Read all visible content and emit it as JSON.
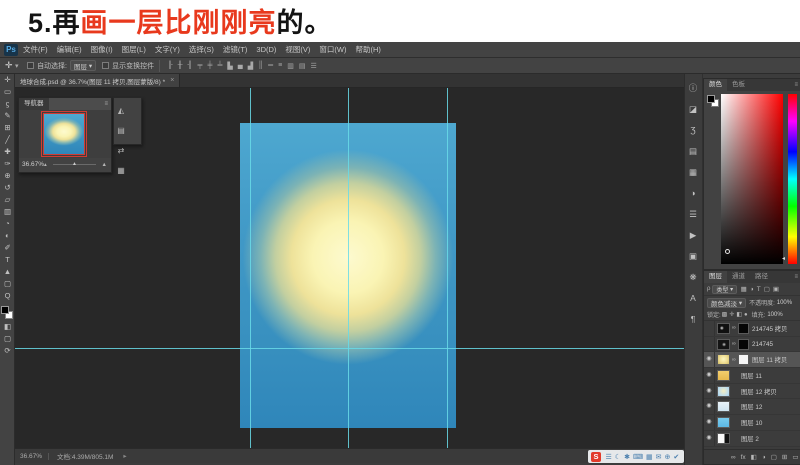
{
  "title": {
    "prefix": "5.再",
    "highlight": "画一层比刚刚亮",
    "suffix": "的。"
  },
  "menu_bar": {
    "logo": "Ps",
    "items": [
      "文件(F)",
      "编辑(E)",
      "图像(I)",
      "图层(L)",
      "文字(Y)",
      "选择(S)",
      "滤镜(T)",
      "3D(D)",
      "视图(V)",
      "窗口(W)",
      "帮助(H)"
    ]
  },
  "options_bar": {
    "tool_glyph": "✛",
    "tool_arrow": "▾",
    "auto_select_label": "自动选择:",
    "auto_select_value": "图层",
    "select_arrow": "▾",
    "transform_label": "显示变换控件",
    "align_icons": [
      "╟",
      "╫",
      "╢",
      "╤",
      "╪",
      "╧",
      "▙",
      "▄",
      "▟",
      "║",
      "═",
      "≡",
      "▥",
      "▤",
      "☰"
    ]
  },
  "toolbar": {
    "tools": [
      "✛",
      "▭",
      "ϛ",
      "✎",
      "⊞",
      "╱",
      "✚",
      "✑",
      "⊕",
      "↺",
      "▱",
      "▥",
      "◔",
      "◐",
      "✐",
      "T",
      "▲",
      "▢",
      "Q"
    ],
    "bottom_icons": [
      "◧",
      "▢",
      "⟳"
    ]
  },
  "document": {
    "tab_title": "地球合成.psd @ 36.7%(图层 11 拷贝,图层蒙版/8) *",
    "close_glyph": "×"
  },
  "navigator": {
    "tab": "导航器",
    "menu_icon": "≡",
    "zoom": "36.67%",
    "slider_thumb": "▲",
    "mount_small": "▴",
    "mount_large": "▲"
  },
  "collapsed_panel": {
    "icons": [
      "◭",
      "▤",
      "⇄",
      "▦"
    ]
  },
  "status_bar": {
    "zoom": "36.67%",
    "doc_info": "文档:4.39M/805.1M",
    "arrow": "▸"
  },
  "sogou": {
    "logo": "S",
    "icons": [
      "☰",
      "☾",
      "✱",
      "⌨",
      "▦",
      "✉",
      "⊕",
      "✔"
    ]
  },
  "right_strip": {
    "icons": [
      "ⓘ",
      "◪",
      "Ʒ",
      "▤",
      "▦",
      "◑",
      "☰",
      "▶",
      "▣",
      "❋",
      "A",
      "¶"
    ]
  },
  "color_panel": {
    "tabs": [
      "颜色",
      "色板"
    ],
    "menu_icon": "≡",
    "hue_marker": "◂"
  },
  "layers_panel": {
    "tabs": [
      "图层",
      "通道",
      "路径"
    ],
    "menu_icon": "≡",
    "filter_prefix": "ρ",
    "filter_label": "类型",
    "filter_arrow": "▾",
    "filter_icons": [
      "▦",
      "◑",
      "T",
      "▢",
      "▣"
    ],
    "blend_mode": "颜色减淡",
    "blend_arrow": "▾",
    "opacity_label": "不透明度:",
    "opacity_value": "100%",
    "lock_label": "锁定:",
    "lock_icons": [
      "▩",
      "✛",
      "◧",
      "●"
    ],
    "fill_label": "填充:",
    "fill_value": "100%",
    "layers": [
      {
        "name": "214745 拷贝",
        "eye": "",
        "thumb": "t-dark1",
        "mask": "m-black",
        "link": "∞",
        "state": ""
      },
      {
        "name": "214745",
        "eye": "",
        "thumb": "t-dark2",
        "mask": "m-black",
        "link": "∞",
        "state": ""
      },
      {
        "name": "图层 11 拷贝",
        "eye": "◉",
        "thumb": "t-glow",
        "mask": "m-white",
        "link": "∞",
        "state": "selected"
      },
      {
        "name": "图层 11",
        "eye": "◉",
        "thumb": "t-yellow",
        "mask": "",
        "link": "",
        "state": ""
      },
      {
        "name": "图层 12 拷贝",
        "eye": "◉",
        "thumb": "t-blue1",
        "mask": "",
        "link": "",
        "state": ""
      },
      {
        "name": "图层 12",
        "eye": "◉",
        "thumb": "t-pale",
        "mask": "",
        "link": "",
        "state": ""
      },
      {
        "name": "图层 10",
        "eye": "◉",
        "thumb": "t-sky",
        "mask": "",
        "link": "",
        "state": ""
      },
      {
        "name": "图层 2",
        "eye": "◉",
        "thumb": "t-split",
        "mask": "",
        "link": "",
        "state": ""
      }
    ],
    "bottom_icons": [
      "∞",
      "fx",
      "◧",
      "◑",
      "▢",
      "⊞",
      "▭"
    ]
  }
}
